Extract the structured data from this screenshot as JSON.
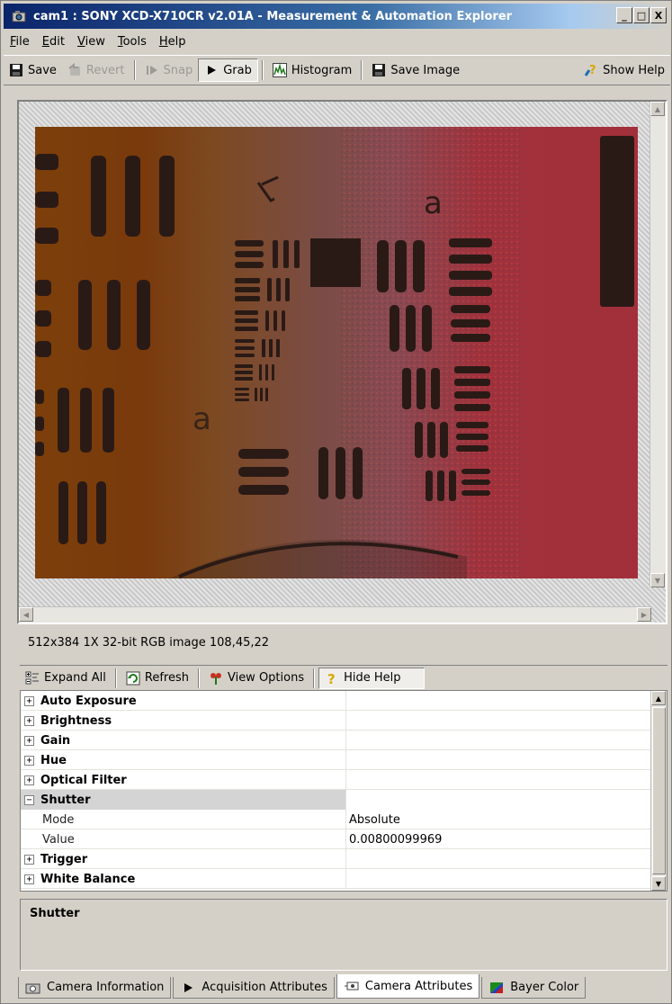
{
  "window": {
    "title": "cam1 : SONY XCD-X710CR v2.01A - Measurement & Automation Explorer",
    "buttons": {
      "minimize": "_",
      "maximize": "□",
      "close": "X"
    }
  },
  "menu": {
    "items": [
      {
        "label": "File",
        "underline": "F",
        "rest": "ile"
      },
      {
        "label": "Edit",
        "underline": "E",
        "rest": "dit"
      },
      {
        "label": "View",
        "underline": "V",
        "rest": "iew"
      },
      {
        "label": "Tools",
        "underline": "T",
        "rest": "ools"
      },
      {
        "label": "Help",
        "underline": "H",
        "rest": "elp"
      }
    ]
  },
  "toolbar": {
    "save_label": "Save",
    "revert_label": "Revert",
    "snap_label": "Snap",
    "grab_label": "Grab",
    "histogram_label": "Histogram",
    "save_image_label": "Save Image",
    "show_help_label": "Show Help"
  },
  "viewer": {
    "status": "512x384  1X  32-bit RGB image  108,45,22"
  },
  "attributes": {
    "toolbar": {
      "expand_all": "Expand All",
      "refresh": "Refresh",
      "view_options": "View Options",
      "hide_help": "Hide Help"
    },
    "rows": [
      {
        "name": "Auto Exposure",
        "value": "",
        "type": "group",
        "expander": "+"
      },
      {
        "name": "Brightness",
        "value": "",
        "type": "group",
        "expander": "+"
      },
      {
        "name": "Gain",
        "value": "",
        "type": "group",
        "expander": "+"
      },
      {
        "name": "Hue",
        "value": "",
        "type": "group",
        "expander": "+"
      },
      {
        "name": "Optical Filter",
        "value": "",
        "type": "group",
        "expander": "+"
      },
      {
        "name": "Shutter",
        "value": "",
        "type": "group",
        "expander": "−",
        "selected": true
      },
      {
        "name": "Mode",
        "value": "Absolute",
        "type": "child"
      },
      {
        "name": "Value",
        "value": "0.00800099969",
        "type": "child"
      },
      {
        "name": "Trigger",
        "value": "",
        "type": "group",
        "expander": "+"
      },
      {
        "name": "White Balance",
        "value": "",
        "type": "group",
        "expander": "+"
      }
    ],
    "help_title": "Shutter"
  },
  "tabs": [
    {
      "label": "Camera Information"
    },
    {
      "label": "Acquisition Attributes"
    },
    {
      "label": "Camera Attributes",
      "active": true
    },
    {
      "label": "Bayer Color"
    }
  ],
  "colors": {
    "title_gradient_start": "#0a246a",
    "chrome": "#d4d0c8",
    "image_left": "#7c3f0a",
    "image_right": "#a1303a",
    "bar_dark": "#2a1a16"
  }
}
